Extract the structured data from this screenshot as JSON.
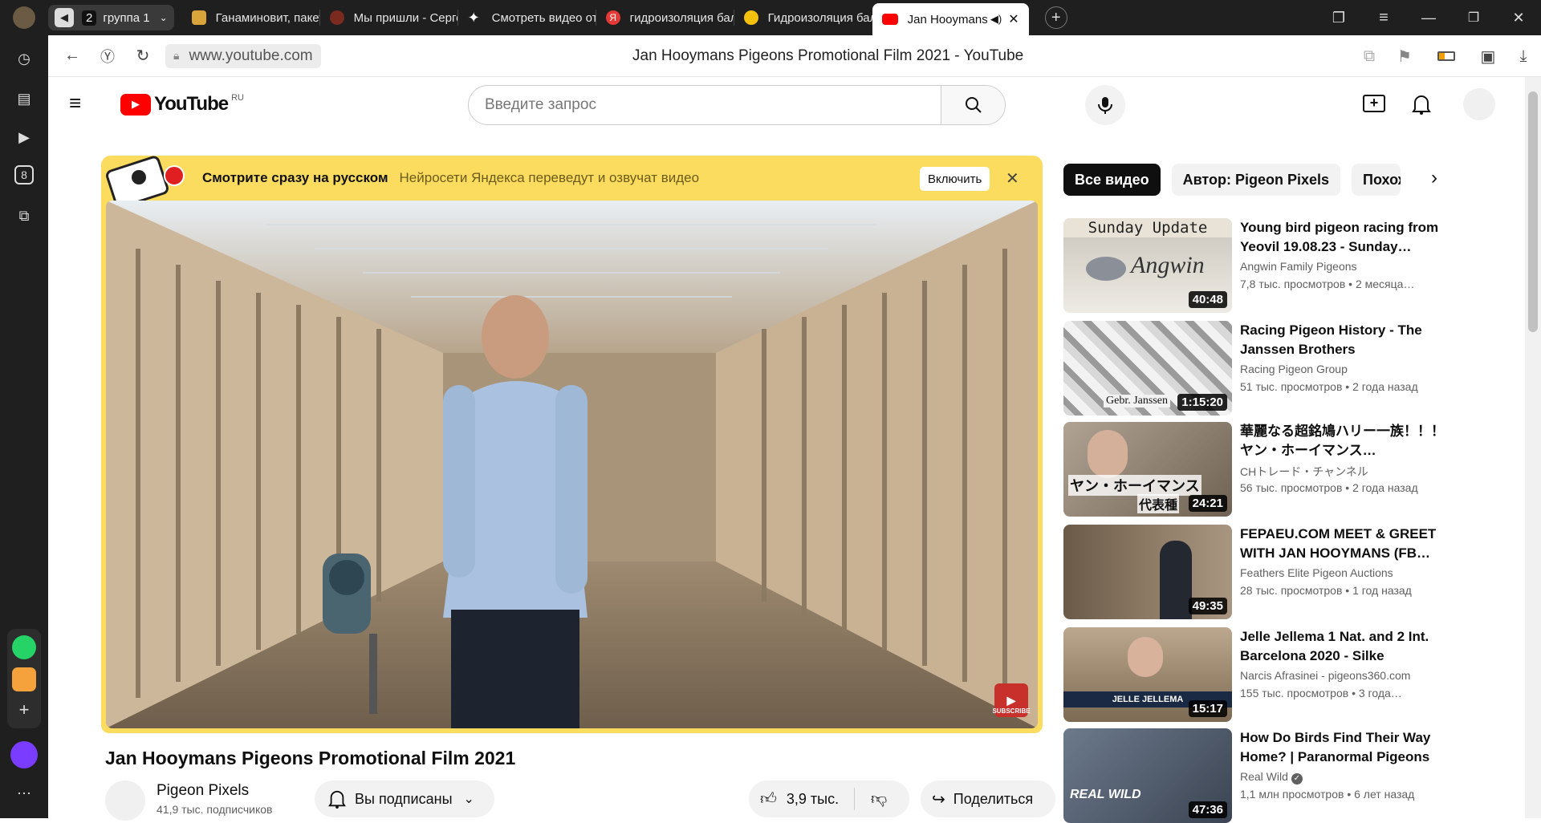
{
  "browser": {
    "tab_group": {
      "count": "2",
      "label": "группа 1"
    },
    "tabs": [
      {
        "label": "Ганаминовит, пакет",
        "color": "#d9a43a"
      },
      {
        "label": "Мы пришли - Сергей",
        "color": "#c0392b"
      },
      {
        "label": "Смотреть видео от л",
        "color": "#ffffff"
      },
      {
        "label": "гидроизоляция балк",
        "color": "#e33"
      },
      {
        "label": "Гидроизоляция балк",
        "color": "#f4c20d"
      },
      {
        "label": "Jan Hooymans P",
        "color": "#ff0000"
      }
    ],
    "url": "www.youtube.com",
    "page_title": "Jan Hooymans Pigeons Promotional Film 2021 - YouTube",
    "sidebar_badge": "8"
  },
  "youtube": {
    "logo_text": "YouTube",
    "region": "RU",
    "search_placeholder": "Введите запрос",
    "banner": {
      "headline": "Смотрите сразу на русском",
      "subtext": "Нейросети Яндекса переведут и озвучат видео",
      "button": "Включить"
    },
    "video": {
      "title": "Jan Hooymans Pigeons Promotional Film 2021",
      "watermark": "SUBSCRIBE"
    },
    "channel": {
      "name": "Pigeon Pixels",
      "subscribers": "41,9 тыс. подписчиков",
      "subscribed_label": "Вы подписаны"
    },
    "actions": {
      "likes": "3,9 тыс.",
      "share": "Поделиться"
    },
    "chips": [
      "Все видео",
      "Автор: Pigeon Pixels",
      "Похожий к"
    ],
    "recommendations": [
      {
        "title": "Young bird pigeon racing from Yeovil 19.08.23 - Sunday…",
        "channel": "Angwin Family Pigeons",
        "meta": "7,8 тыс. просмотров • 2 месяца…",
        "duration": "40:48",
        "thumb_text": "Sunday Update",
        "thumb_sub": "Angwin"
      },
      {
        "title": "Racing Pigeon History - The Janssen Brothers",
        "channel": "Racing Pigeon Group",
        "meta": "51 тыс. просмотров • 2 года назад",
        "duration": "1:15:20",
        "thumb_text": "Gebr. Janssen"
      },
      {
        "title": "華麗なる超銘鳩ハリー一族！！！ ヤン・ホーイマンス…",
        "channel": "CHトレード・チャンネル",
        "meta": "56 тыс. просмотров • 2 года назад",
        "duration": "24:21",
        "thumb_text": "ヤン・ホーイマンス",
        "thumb_sub": "代表種"
      },
      {
        "title": "FEPAEU.COM MEET & GREET WITH JAN HOOYMANS (FB…",
        "channel": "Feathers Elite Pigeon Auctions",
        "meta": "28 тыс. просмотров • 1 год назад",
        "duration": "49:35"
      },
      {
        "title": "Jelle Jellema 1 Nat. and 2 Int. Barcelona 2020 - Silke",
        "channel": "Narcis Afrasinei - pigeons360.com",
        "meta": "155 тыс. просмотров • 3 года…",
        "duration": "15:17",
        "thumb_text": "JELLE JELLEMA"
      },
      {
        "title": "How Do Birds Find Their Way Home? | Paranormal Pigeons |…",
        "channel": "Real Wild",
        "meta": "1,1 млн просмотров • 6 лет назад",
        "duration": "47:36",
        "thumb_text": "REAL WILD"
      }
    ]
  }
}
